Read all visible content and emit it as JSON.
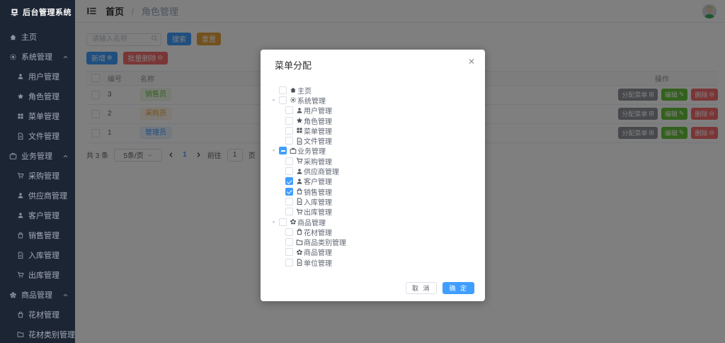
{
  "app": {
    "title": "后台管理系统"
  },
  "sidebar": {
    "items": [
      {
        "label": "主页",
        "icon": "home",
        "type": "item",
        "caret": false
      },
      {
        "label": "系统管理",
        "icon": "gear",
        "type": "section",
        "caret": true
      },
      {
        "label": "用户管理",
        "icon": "user",
        "type": "child",
        "caret": false
      },
      {
        "label": "角色管理",
        "icon": "star",
        "type": "child",
        "caret": false
      },
      {
        "label": "菜单管理",
        "icon": "grid",
        "type": "child",
        "caret": false
      },
      {
        "label": "文件管理",
        "icon": "doc",
        "type": "child",
        "caret": false
      },
      {
        "label": "业务管理",
        "icon": "briefcase",
        "type": "section",
        "caret": true
      },
      {
        "label": "采购管理",
        "icon": "cart",
        "type": "child",
        "caret": false
      },
      {
        "label": "供应商管理",
        "icon": "user",
        "type": "child",
        "caret": false
      },
      {
        "label": "客户管理",
        "icon": "user",
        "type": "child",
        "caret": false
      },
      {
        "label": "销售管理",
        "icon": "bag",
        "type": "child",
        "caret": false
      },
      {
        "label": "入库管理",
        "icon": "doc",
        "type": "child",
        "caret": false
      },
      {
        "label": "出库管理",
        "icon": "cart",
        "type": "child",
        "caret": false
      },
      {
        "label": "商品管理",
        "icon": "flower",
        "type": "section",
        "caret": true
      },
      {
        "label": "花材管理",
        "icon": "bag",
        "type": "child",
        "caret": false
      },
      {
        "label": "花材类别管理",
        "icon": "folder",
        "type": "child",
        "caret": false
      }
    ]
  },
  "header": {
    "breadcrumb": {
      "home": "首页",
      "separator": "/",
      "current": "角色管理"
    },
    "fold_icon": "fold-menu",
    "avatar_icon": "user-avatar"
  },
  "toolbar": {
    "search_placeholder": "请输入名称",
    "search_label": "搜索",
    "reset_label": "重置",
    "add_label": "新增",
    "batch_delete_label": "批量删除",
    "add_icon": "circle-plus",
    "batch_delete_icon": "circle-minus",
    "search_icon": "magnifier"
  },
  "table": {
    "columns": {
      "id": "编号",
      "name": "名称",
      "ops": "操作"
    },
    "rows": [
      {
        "id": "3",
        "name": "销售员",
        "tag": "success"
      },
      {
        "id": "2",
        "name": "采购员",
        "tag": "warning"
      },
      {
        "id": "1",
        "name": "管理员",
        "tag": "primary"
      }
    ],
    "actions": {
      "assign_label": "分配菜单",
      "assign_icon": "grid",
      "edit_label": "编辑",
      "edit_icon": "pencil",
      "delete_label": "删除",
      "delete_icon": "circle-minus"
    }
  },
  "pagination": {
    "total_text": "共 3 条",
    "page_size_text": "5条/页",
    "current_page": "1",
    "goto_label": "前往",
    "goto_value": "1",
    "page_unit": "页"
  },
  "modal": {
    "title": "菜单分配",
    "close_icon": "close",
    "cancel_label": "取 消",
    "confirm_label": "确 定",
    "tree": [
      {
        "label": "主页",
        "icon": "home",
        "depth": 1,
        "checked": "no",
        "caret": false
      },
      {
        "label": "系统管理",
        "icon": "gear",
        "depth": 1,
        "checked": "no",
        "caret": true
      },
      {
        "label": "用户管理",
        "icon": "user",
        "depth": 2,
        "checked": "no",
        "caret": false
      },
      {
        "label": "角色管理",
        "icon": "star",
        "depth": 2,
        "checked": "no",
        "caret": false
      },
      {
        "label": "菜单管理",
        "icon": "grid",
        "depth": 2,
        "checked": "no",
        "caret": false
      },
      {
        "label": "文件管理",
        "icon": "doc",
        "depth": 2,
        "checked": "no",
        "caret": false
      },
      {
        "label": "业务管理",
        "icon": "briefcase",
        "depth": 1,
        "checked": "indet",
        "caret": true
      },
      {
        "label": "采购管理",
        "icon": "cart",
        "depth": 2,
        "checked": "no",
        "caret": false
      },
      {
        "label": "供应商管理",
        "icon": "user",
        "depth": 2,
        "checked": "no",
        "caret": false
      },
      {
        "label": "客户管理",
        "icon": "user",
        "depth": 2,
        "checked": "yes",
        "caret": false
      },
      {
        "label": "销售管理",
        "icon": "bag",
        "depth": 2,
        "checked": "yes",
        "caret": false
      },
      {
        "label": "入库管理",
        "icon": "doc",
        "depth": 2,
        "checked": "no",
        "caret": false
      },
      {
        "label": "出库管理",
        "icon": "cart",
        "depth": 2,
        "checked": "no",
        "caret": false
      },
      {
        "label": "商品管理",
        "icon": "flower",
        "depth": 1,
        "checked": "no",
        "caret": true
      },
      {
        "label": "花材管理",
        "icon": "bag",
        "depth": 2,
        "checked": "no",
        "caret": false
      },
      {
        "label": "商品类别管理",
        "icon": "folder",
        "depth": 2,
        "checked": "no",
        "caret": false
      },
      {
        "label": "商品管理",
        "icon": "flower",
        "depth": 2,
        "checked": "no",
        "caret": false
      },
      {
        "label": "单位管理",
        "icon": "doc",
        "depth": 2,
        "checked": "no",
        "caret": false
      }
    ]
  },
  "colors": {
    "primary": "#409eff",
    "success": "#67c23a",
    "warning": "#e6a23c",
    "danger": "#f56c6c",
    "info": "#909399",
    "sidebar_bg": "#1c2533"
  }
}
